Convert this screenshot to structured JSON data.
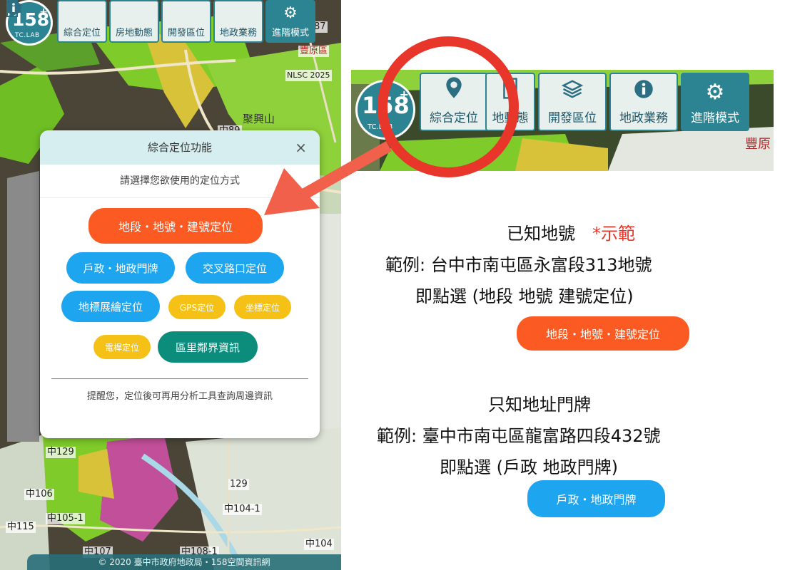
{
  "toolbar": {
    "logo_number": "158",
    "logo_sub": "TC.LAB",
    "buttons": [
      {
        "label": "綜合定位",
        "icon": "map-pin-icon"
      },
      {
        "label": "房地動態",
        "icon": "building-icon"
      },
      {
        "label": "開發區位",
        "icon": "layers-icon"
      },
      {
        "label": "地政業務",
        "icon": "info-icon"
      },
      {
        "label": "進階模式",
        "icon": "gear-icon"
      }
    ]
  },
  "zoom_toolbar": {
    "buttons": [
      {
        "label": "綜合定位"
      },
      {
        "label": "地動態"
      },
      {
        "label": "開發區位"
      },
      {
        "label": "地政業務"
      },
      {
        "label": "進階模式"
      }
    ],
    "map_text": "豐原"
  },
  "map": {
    "labels": [
      "中87",
      "豐原區",
      "聚興山",
      "中89",
      "中129",
      "中106",
      "中105-1",
      "中115",
      "129",
      "中104-1",
      "中107",
      "中108-1",
      "中104",
      "NLSC 2025"
    ],
    "copyright": "© 2020 臺中市政府地政局・158空間資訊網"
  },
  "dialog": {
    "title": "綜合定位功能",
    "close": "×",
    "subtitle": "請選擇您欲使用的定位方式",
    "buttons": {
      "parcel": "地段・地號・建號定位",
      "household": "戶政・地政門牌",
      "intersection": "交叉路口定位",
      "landmark": "地標展繪定位",
      "gps": "GPS定位",
      "coordinate": "坐標定位",
      "pole": "電桿定位",
      "district": "區里鄰界資訊"
    },
    "footer": "提醒您，定位後可再用分析工具查詢周邊資訊"
  },
  "instructions": {
    "case1_title": "已知地號",
    "case1_demo": "*示範",
    "case1_example": "範例: 台中市南屯區永富段313地號",
    "case1_action": "即點選 (地段 地號 建號定位)",
    "case1_button": "地段・地號・建號定位",
    "case2_title": "只知地址門牌",
    "case2_example": "範例: 臺中市南屯區龍富路四段432號",
    "case2_action": "即點選 (戶政 地政門牌)",
    "case2_button": "戶政・地政門牌"
  },
  "colors": {
    "orange": "#fb5a22",
    "blue": "#1ea5f0",
    "yellow": "#f6c117",
    "teal": "#0c8c7a",
    "annotation_red": "#e8362a"
  }
}
